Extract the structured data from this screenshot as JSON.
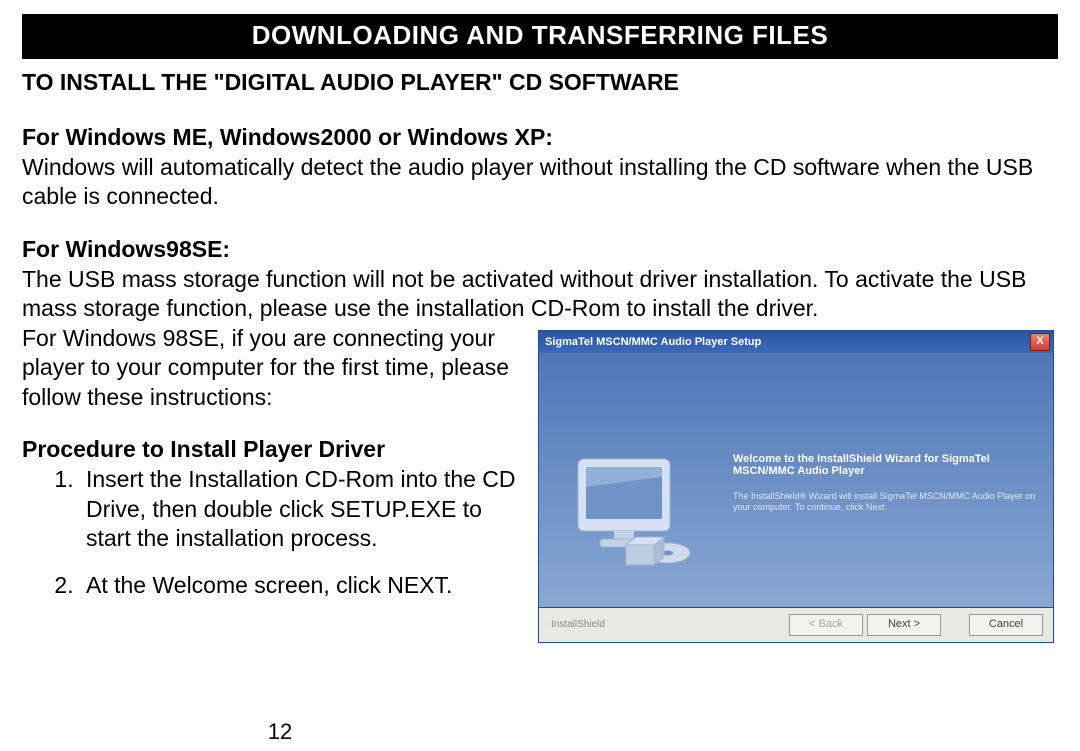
{
  "banner": "DOWNLOADING AND TRANSFERRING FILES",
  "subtitle": "TO INSTALL THE \"DIGITAL AUDIO PLAYER\" CD SOFTWARE",
  "sec1_h": "For Windows ME, Windows2000 or Windows XP:",
  "sec1_b": "Windows will automatically detect the audio player without installing the CD software when the USB cable is connected.",
  "sec2_h": "For Windows98SE:",
  "sec2_b": "The USB mass storage function will not be activated without driver installation. To activate the USB mass storage function, please use the installation CD-Rom to install the driver.",
  "sec2_c": "For Windows 98SE, if you are connecting your player to your computer for the first time, please follow these instructions:",
  "proc_h": "Procedure to Install Player Driver",
  "step1": "Insert the Installation CD-Rom into the CD Drive, then double click SETUP.EXE to start the installation process.",
  "step2": "At the Welcome screen, click NEXT.",
  "page_number": "12",
  "installer": {
    "title": "SigmaTel MSCN/MMC Audio Player Setup",
    "welcome": "Welcome to the InstallShield Wizard for SigmaTel MSCN/MMC Audio Player",
    "desc": "The InstallShield® Wizard will install SigmaTel MSCN/MMC Audio Player on your computer. To continue, click Next.",
    "brand": "InstallShield",
    "back": "< Back",
    "next": "Next >",
    "cancel": "Cancel"
  }
}
